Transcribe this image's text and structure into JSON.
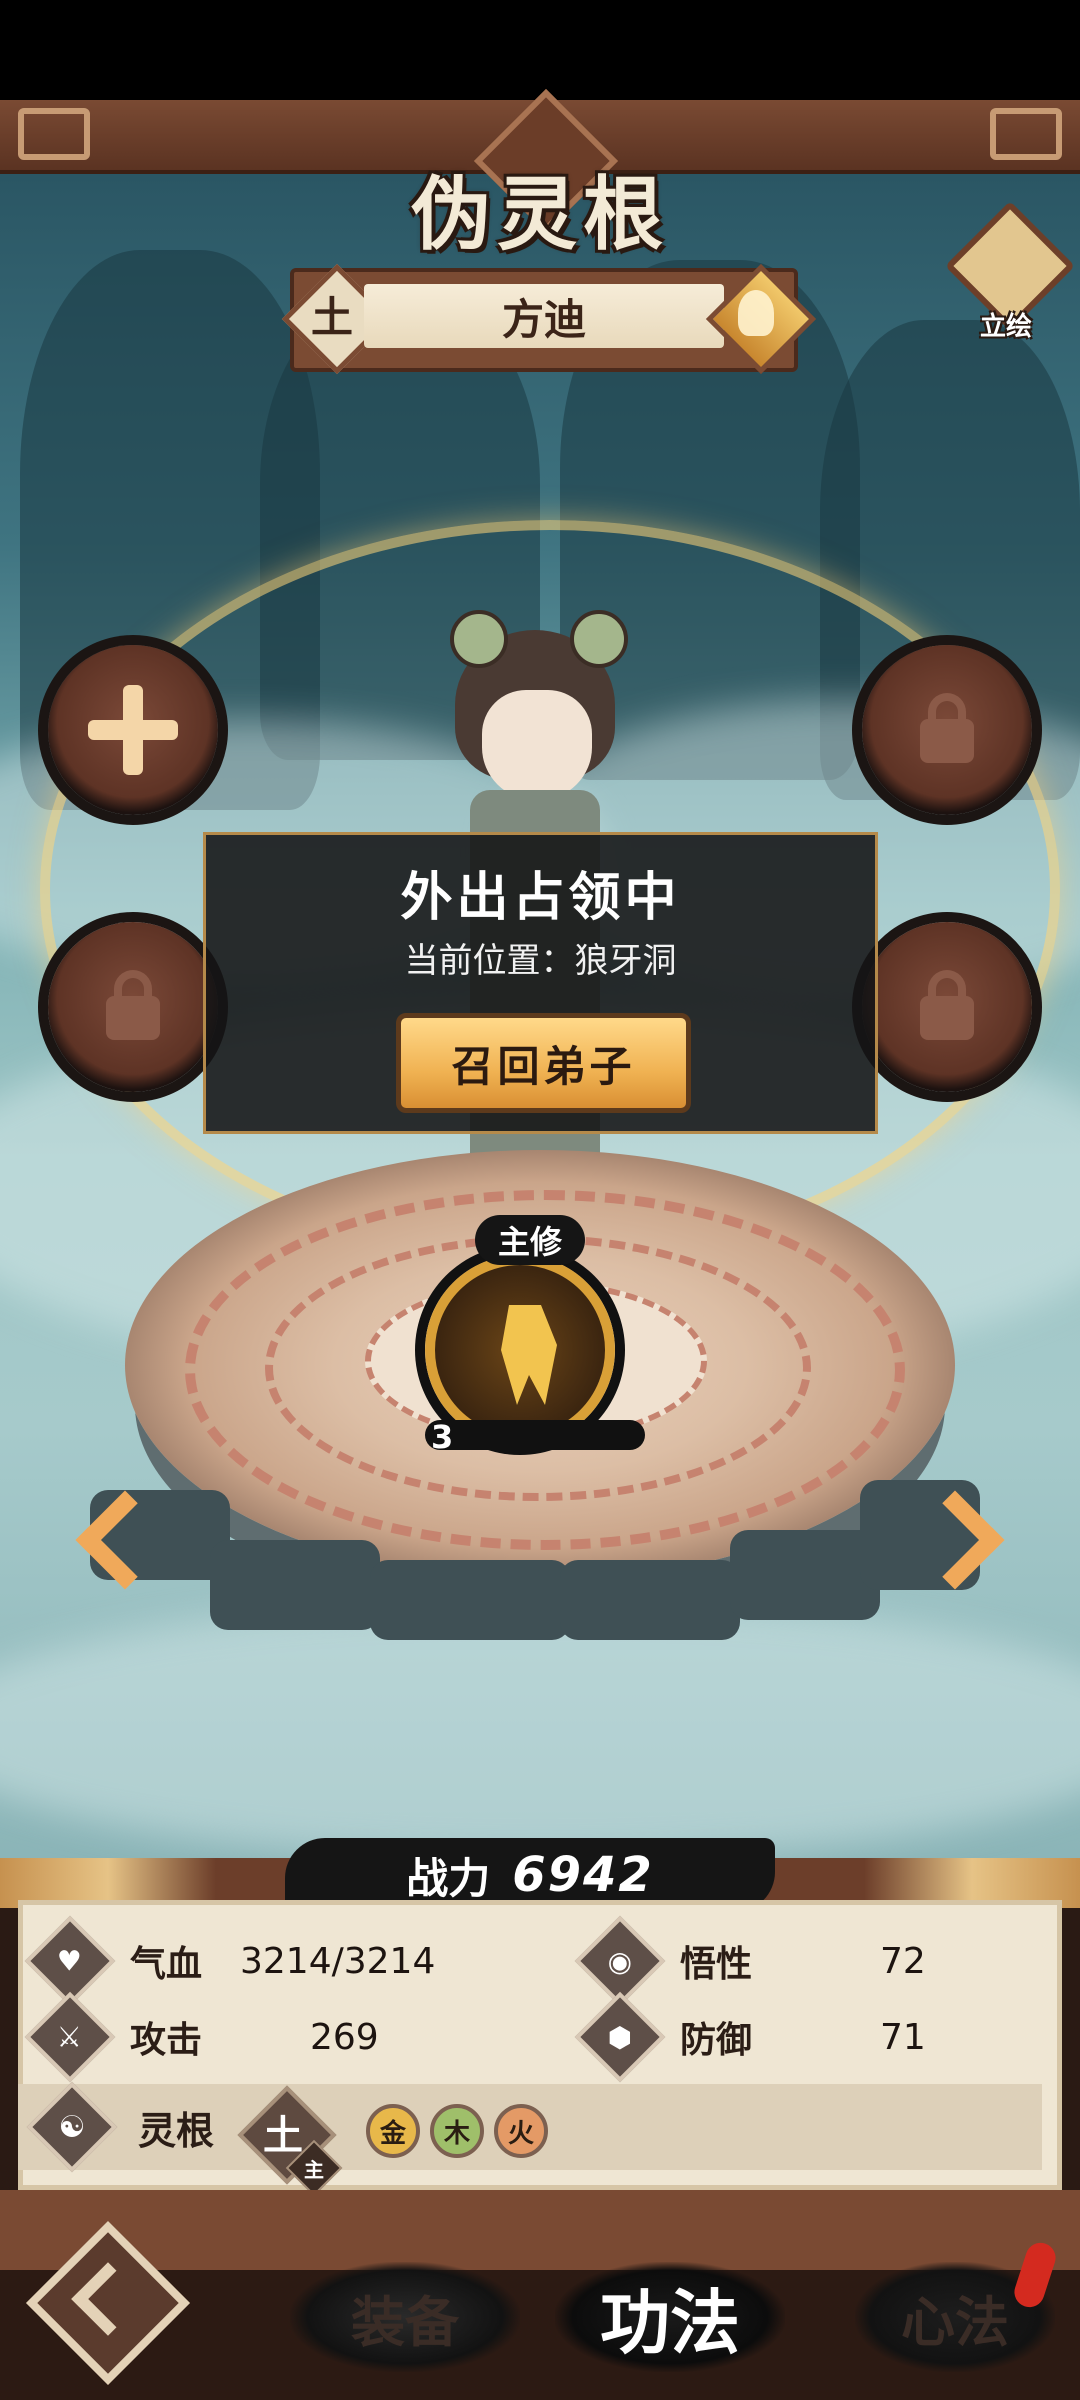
{
  "header": {
    "title": "伪灵根",
    "element": "土",
    "disciple_name": "方迪",
    "portrait_label": "立绘"
  },
  "status_overlay": {
    "title": "外出占领中",
    "location": "当前位置：狼牙洞",
    "recall_button": "召回弟子"
  },
  "main_skill": {
    "tag": "主修",
    "level": "3"
  },
  "power": {
    "label": "战力",
    "value": "6942"
  },
  "stats": {
    "hp_label": "气血",
    "hp_value": "3214/3214",
    "comprehension_label": "悟性",
    "comprehension_value": "72",
    "attack_label": "攻击",
    "attack_value": "269",
    "defense_label": "防御",
    "defense_value": "71"
  },
  "spirit_root": {
    "label": "灵根",
    "main": "土",
    "main_tag": "主",
    "others": [
      "金",
      "木",
      "火"
    ]
  },
  "nav": {
    "equip": "装备",
    "skill": "功法",
    "mind": "心法"
  },
  "icons": {
    "hp": "heart-icon",
    "comprehension": "eye-icon",
    "attack": "sword-icon",
    "defense": "shield-icon",
    "spirit_root": "yin-yang-icon"
  },
  "colors": {
    "accent_gold": "#f0b252",
    "panel_cream": "#efe6d3",
    "frame_brown": "#7a4a33"
  }
}
